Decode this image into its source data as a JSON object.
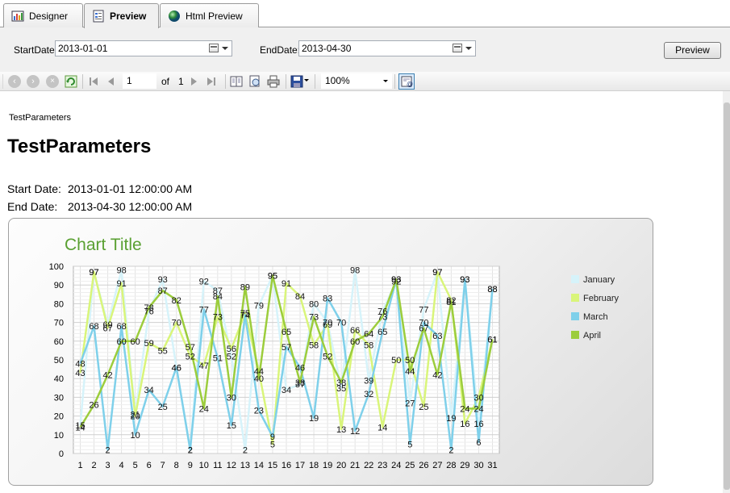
{
  "tabs": [
    {
      "label": "Designer",
      "icon": "designer-icon"
    },
    {
      "label": "Preview",
      "icon": "preview-icon"
    },
    {
      "label": "Html Preview",
      "icon": "globe-icon"
    }
  ],
  "params": {
    "start_label": "StartDate:",
    "start_value": "2013-01-01",
    "end_label": "EndDate:",
    "end_value": "2013-04-30",
    "preview_button": "Preview"
  },
  "toolbar": {
    "page": "1",
    "of_label": "of",
    "total_pages": "1",
    "zoom": "100%"
  },
  "report": {
    "small_title": "TestParameters",
    "title": "TestParameters",
    "start_label": "Start Date:",
    "start_value": "2013-01-01 12:00:00 AM",
    "end_label": "End Date:",
    "end_value": "2013-04-30 12:00:00 AM"
  },
  "chart_data": {
    "type": "line",
    "title": "Chart Title",
    "xlabel": "",
    "ylabel": "",
    "ylim": [
      0,
      100
    ],
    "yticks": [
      0,
      10,
      20,
      30,
      40,
      50,
      60,
      70,
      80,
      90,
      100
    ],
    "x": [
      1,
      2,
      3,
      4,
      5,
      6,
      7,
      8,
      9,
      10,
      11,
      12,
      13,
      14,
      15,
      16,
      17,
      18,
      19,
      20,
      21,
      22,
      23,
      24,
      25,
      26,
      27,
      28,
      29,
      30,
      31
    ],
    "grid": true,
    "legend_position": "right",
    "series": [
      {
        "name": "January",
        "color": "#d6f3fa",
        "values": [
          15,
          97,
          69,
          98,
          21,
          76,
          93,
          46,
          2,
          92,
          87,
          52,
          2,
          79,
          95,
          34,
          37,
          80,
          70,
          35,
          98,
          39,
          76,
          92,
          27,
          77,
          97,
          19,
          93,
          16,
          88
        ]
      },
      {
        "name": "February",
        "color": "#d9f57a",
        "values": [
          43,
          97,
          67,
          91,
          20,
          59,
          55,
          70,
          52,
          47,
          73,
          56,
          75,
          44,
          5,
          91,
          84,
          58,
          69,
          13,
          66,
          58,
          14,
          50,
          50,
          25,
          97,
          82,
          16,
          30,
          61
        ]
      },
      {
        "name": "March",
        "color": "#7fd0ea",
        "values": [
          48,
          68,
          2,
          68,
          10,
          34,
          25,
          46,
          2,
          77,
          51,
          15,
          74,
          23,
          9,
          57,
          46,
          19,
          83,
          70,
          12,
          32,
          65,
          93,
          5,
          70,
          63,
          2,
          93,
          6,
          88
        ]
      },
      {
        "name": "April",
        "color": "#9ccd3c",
        "values": [
          14,
          26,
          42,
          60,
          60,
          78,
          87,
          82,
          57,
          24,
          84,
          30,
          89,
          40,
          95,
          65,
          38,
          73,
          52,
          38,
          60,
          64,
          73,
          93,
          44,
          67,
          42,
          81,
          24,
          24,
          61
        ]
      }
    ]
  }
}
